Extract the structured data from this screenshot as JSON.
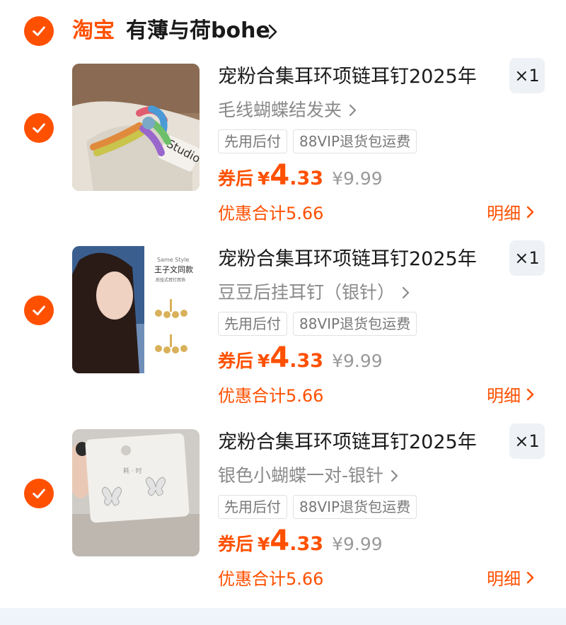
{
  "shop": {
    "platform": "淘宝",
    "name": "有薄与荷bohe"
  },
  "colors": {
    "accent": "#ff5000",
    "muted": "#8a8a8a",
    "tag_border": "#e1e1e1",
    "qty_bg": "#eef1f5"
  },
  "items": [
    {
      "title": "宠粉合集耳环项链耳钉2025年",
      "variant": "毛线蝴蝶结发夹",
      "quantity": "×1",
      "tags": [
        "先用后付",
        "88VIP退货包运费"
      ],
      "price_label": "券后",
      "currency": "¥",
      "price_int": "4",
      "price_dec": ".33",
      "original_price": "¥9.99",
      "discount_text": "优惠合计5.66",
      "detail_label": "明细",
      "image": "knitted-bow-hairclip-photo",
      "image_text": "Studio"
    },
    {
      "title": "宠粉合集耳环项链耳钉2025年",
      "variant": "豆豆后挂耳钉（银针）",
      "quantity": "×1",
      "tags": [
        "先用后付",
        "88VIP退货包运费"
      ],
      "price_label": "券后",
      "currency": "¥",
      "price_int": "4",
      "price_dec": ".33",
      "original_price": "¥9.99",
      "discount_text": "优惠合计5.66",
      "detail_label": "明细",
      "image": "model-with-bead-earrings-photo",
      "image_text_1": "Same Style",
      "image_text_2": "王子文同款",
      "image_text_3": "后挂式耳钉耳饰"
    },
    {
      "title": "宠粉合集耳环项链耳钉2025年",
      "variant": "银色小蝴蝶一对-银针",
      "quantity": "×1",
      "tags": [
        "先用后付",
        "88VIP退货包运费"
      ],
      "price_label": "券后",
      "currency": "¥",
      "price_int": "4",
      "price_dec": ".33",
      "original_price": "¥9.99",
      "discount_text": "优惠合计5.66",
      "detail_label": "明细",
      "image": "butterfly-stud-earrings-card-photo"
    }
  ]
}
